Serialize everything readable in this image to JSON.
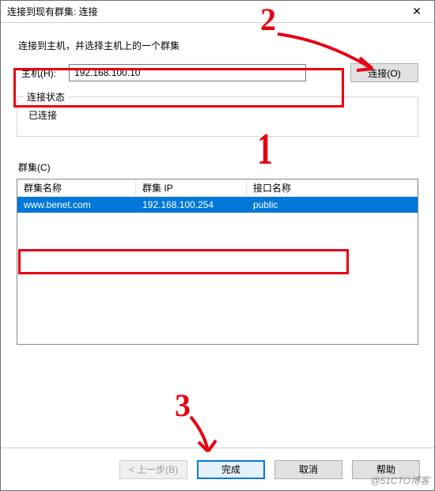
{
  "window": {
    "title": "连接到现有群集: 连接"
  },
  "instructions": "连接到主机，并选择主机上的一个群集",
  "host": {
    "label": "主机(H):",
    "value": "192.168.100.10"
  },
  "connect_button": "连接(O)",
  "status_group": {
    "legend": "连接状态",
    "text": "已连接"
  },
  "clusters": {
    "label": "群集(C)",
    "columns": {
      "name": "群集名称",
      "ip": "群集 IP",
      "iface": "接口名称"
    },
    "rows": [
      {
        "name": "www.benet.com",
        "ip": "192.168.100.254",
        "iface": "public"
      }
    ]
  },
  "footer": {
    "prev": "< 上一步(B)",
    "finish": "完成",
    "cancel": "取消",
    "help": "帮助"
  },
  "annotations": {
    "n1": "1",
    "n2": "2",
    "n3": "3"
  },
  "watermark": "@51CTO博客"
}
